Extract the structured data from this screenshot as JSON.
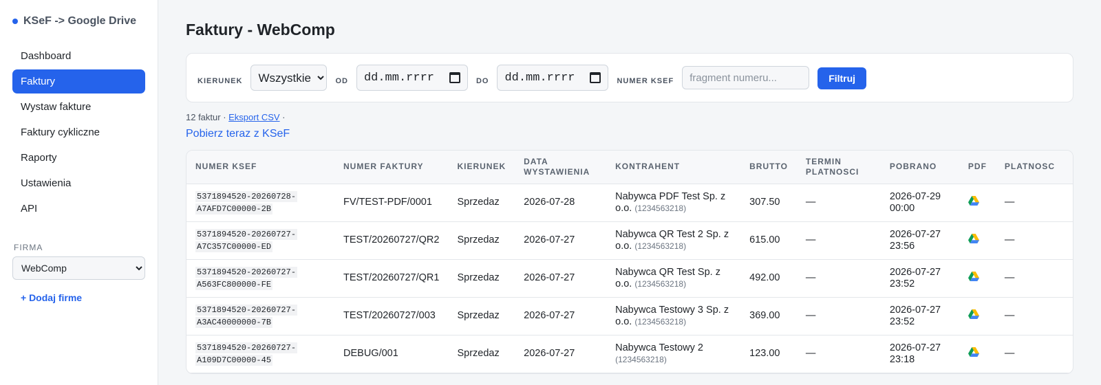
{
  "sidebar": {
    "brand": "KSeF -> Google Drive",
    "items": [
      {
        "label": "Dashboard",
        "active": false
      },
      {
        "label": "Faktury",
        "active": true
      },
      {
        "label": "Wystaw fakture",
        "active": false
      },
      {
        "label": "Faktury cykliczne",
        "active": false
      },
      {
        "label": "Raporty",
        "active": false
      },
      {
        "label": "Ustawienia",
        "active": false
      },
      {
        "label": "API",
        "active": false
      }
    ],
    "firm_label": "FIRMA",
    "firm_selected": "WebComp",
    "add_firm": "+ Dodaj firme"
  },
  "page": {
    "title": "Faktury - WebComp"
  },
  "filters": {
    "direction_label": "KIERUNEK",
    "direction_value": "Wszystkie",
    "from_label": "OD",
    "from_value": "dd.mm.rrrr",
    "to_label": "DO",
    "to_value": "dd.mm.rrrr",
    "ksef_label": "NUMER KSEF",
    "ksef_placeholder": "fragment numeru...",
    "submit": "Filtruj"
  },
  "summary": {
    "count_text": "12 faktur · ",
    "export_link": "Eksport CSV",
    "suffix": " ·",
    "fetch_link": "Pobierz teraz z KSeF"
  },
  "table": {
    "columns": [
      "NUMER KSEF",
      "NUMER FAKTURY",
      "KIERUNEK",
      "DATA WYSTAWIENIA",
      "KONTRAHENT",
      "BRUTTO",
      "TERMIN PLATNOSCI",
      "POBRANO",
      "PDF",
      "PLATNOSC"
    ],
    "rows": [
      {
        "ksef_a": "5371894520-20260728-",
        "ksef_b": "A7AFD7C00000-2B",
        "invoice": "FV/TEST-PDF/0001",
        "direction": "Sprzedaz",
        "date": "2026-07-28",
        "contractor": "Nabywca PDF Test Sp. z o.o.",
        "nip": "(1234563218)",
        "gross": "307.50",
        "due": "—",
        "fetched_a": "2026-07-29",
        "fetched_b": "00:00",
        "payment": "—"
      },
      {
        "ksef_a": "5371894520-20260727-",
        "ksef_b": "A7C357C00000-ED",
        "invoice": "TEST/20260727/QR2",
        "direction": "Sprzedaz",
        "date": "2026-07-27",
        "contractor": "Nabywca QR Test 2 Sp. z o.o.",
        "nip": "(1234563218)",
        "gross": "615.00",
        "due": "—",
        "fetched_a": "2026-07-27",
        "fetched_b": "23:56",
        "payment": "—"
      },
      {
        "ksef_a": "5371894520-20260727-",
        "ksef_b": "A563FC800000-FE",
        "invoice": "TEST/20260727/QR1",
        "direction": "Sprzedaz",
        "date": "2026-07-27",
        "contractor": "Nabywca QR Test Sp. z o.o.",
        "nip": "(1234563218)",
        "gross": "492.00",
        "due": "—",
        "fetched_a": "2026-07-27",
        "fetched_b": "23:52",
        "payment": "—"
      },
      {
        "ksef_a": "5371894520-20260727-",
        "ksef_b": "A3AC40000000-7B",
        "invoice": "TEST/20260727/003",
        "direction": "Sprzedaz",
        "date": "2026-07-27",
        "contractor": "Nabywca Testowy 3 Sp. z o.o.",
        "nip": "(1234563218)",
        "gross": "369.00",
        "due": "—",
        "fetched_a": "2026-07-27",
        "fetched_b": "23:52",
        "payment": "—"
      },
      {
        "ksef_a": "5371894520-20260727-",
        "ksef_b": "A109D7C00000-45",
        "invoice": "DEBUG/001",
        "direction": "Sprzedaz",
        "date": "2026-07-27",
        "contractor": "Nabywca Testowy 2",
        "nip": "(1234563218)",
        "gross": "123.00",
        "due": "—",
        "fetched_a": "2026-07-27",
        "fetched_b": "23:18",
        "payment": "—"
      }
    ]
  },
  "colors": {
    "accent": "#2563eb"
  },
  "icons": {
    "pdf": "google-drive-icon",
    "calendar": "calendar-icon"
  }
}
